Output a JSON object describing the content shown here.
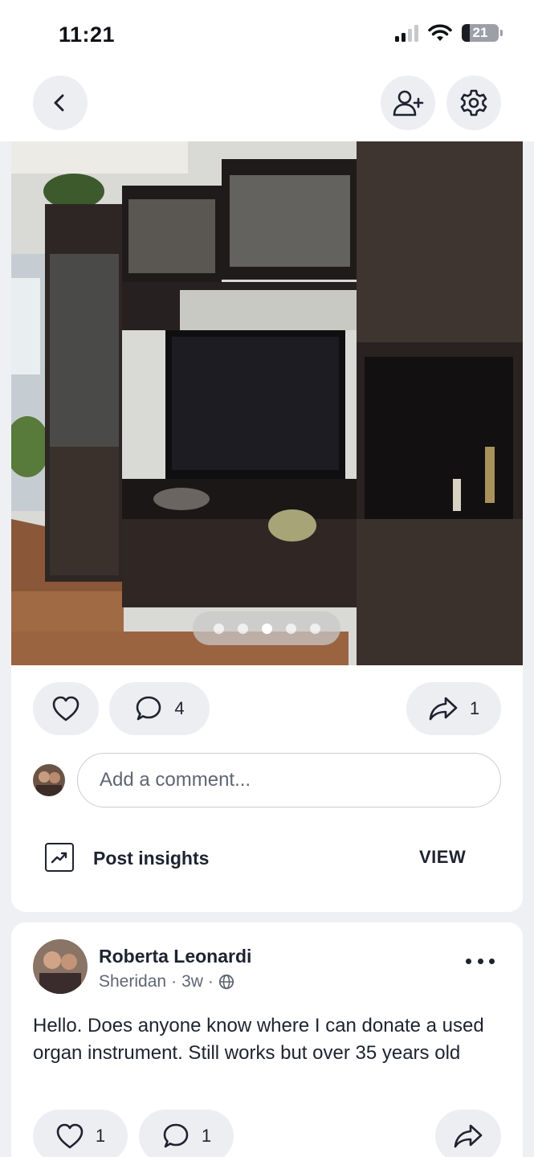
{
  "status_bar": {
    "time": "11:21",
    "battery": "21"
  },
  "header": {
    "back_icon": "chevron-left-icon",
    "add_friend_icon": "person-plus-icon",
    "settings_icon": "gear-icon"
  },
  "post1": {
    "photo_desc_icon": "photo",
    "carousel": {
      "count": 5,
      "active_index": 2
    },
    "like_count": "",
    "comment_count": "4",
    "share_count": "1",
    "comment_placeholder": "Add a comment...",
    "insights_label": "Post insights",
    "view_label": "VIEW"
  },
  "post2": {
    "author": "Roberta Leonardi",
    "location": "Sheridan",
    "age": "3w",
    "text": "Hello. Does anyone know where I can donate a used organ instrument.  Still works but over 35 years old",
    "like_count": "1",
    "comment_count": "1"
  },
  "colors": {
    "background": "#eef0f4",
    "pill": "#eceef2",
    "text": "#1e2330",
    "muted": "#5f6572"
  }
}
